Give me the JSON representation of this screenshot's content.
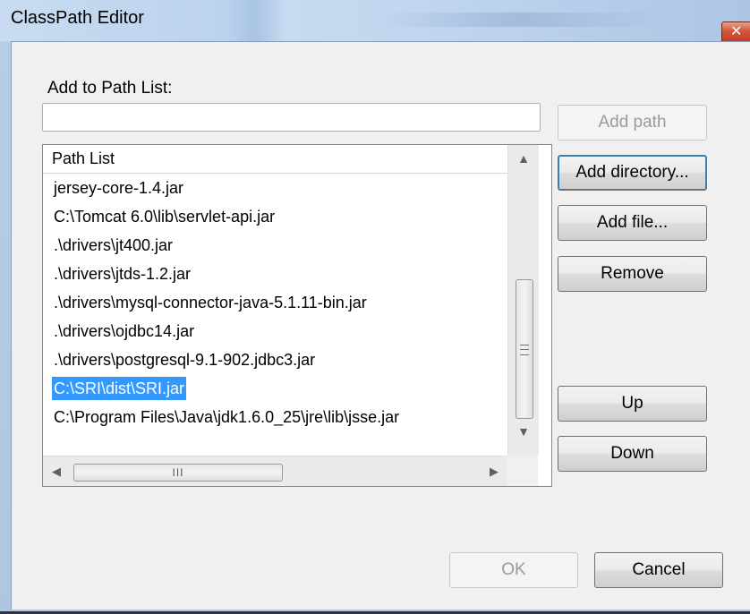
{
  "window": {
    "title": "ClassPath Editor",
    "close_glyph": "✕"
  },
  "add_section": {
    "label": "Add to Path List:",
    "input_value": "",
    "input_placeholder": ""
  },
  "buttons": {
    "add_path": "Add path",
    "add_directory": "Add directory...",
    "add_file": "Add file...",
    "remove": "Remove",
    "up": "Up",
    "down": "Down",
    "ok": "OK",
    "cancel": "Cancel"
  },
  "path_list": {
    "header": "Path List",
    "items": [
      "jersey-core-1.4.jar",
      "C:\\Tomcat 6.0\\lib\\servlet-api.jar",
      ".\\drivers\\jt400.jar",
      ".\\drivers\\jtds-1.2.jar",
      ".\\drivers\\mysql-connector-java-5.1.11-bin.jar",
      ".\\drivers\\ojdbc14.jar",
      ".\\drivers\\postgresql-9.1-902.jdbc3.jar",
      "C:\\SRI\\dist\\SRI.jar",
      "C:\\Program Files\\Java\\jdk1.6.0_25\\jre\\lib\\jsse.jar"
    ],
    "selected_index": 7
  },
  "scrollbars": {
    "up_glyph": "▲",
    "down_glyph": "▼",
    "left_glyph": "◀",
    "right_glyph": "▶",
    "v_grip": "≡",
    "h_grip": "III"
  },
  "colors": {
    "selection": "#3399ff",
    "disabled_text": "#9a9a9a"
  }
}
